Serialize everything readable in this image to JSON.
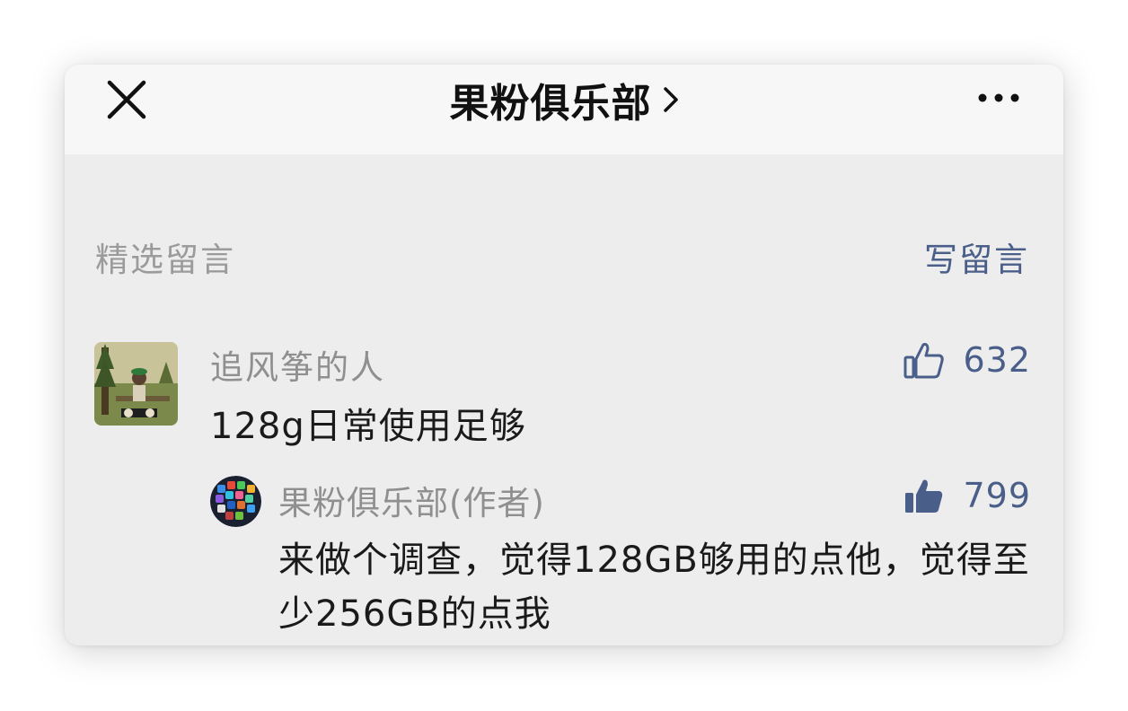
{
  "header": {
    "title": "果粉俱乐部",
    "close_icon": "close-icon",
    "chevron_icon": "chevron-right-icon",
    "more_icon": "more-horizontal-icon"
  },
  "comments_section": {
    "title": "精选留言",
    "write_label": "写留言",
    "accent_color": "#4a5e8a"
  },
  "comments": [
    {
      "author": "追风筝的人",
      "text": "128g日常使用足够",
      "likes": "632",
      "liked": false,
      "like_icon": "thumbs-up-outline-icon",
      "avatar_icon": "landscape-avatar",
      "reply": {
        "author": "果粉俱乐部(作者)",
        "text": "来做个调查，觉得128GB够用的点他，觉得至少256GB的点我",
        "likes": "799",
        "liked": true,
        "like_icon": "thumbs-up-filled-icon",
        "avatar_icon": "app-icons-globe-avatar"
      }
    }
  ]
}
